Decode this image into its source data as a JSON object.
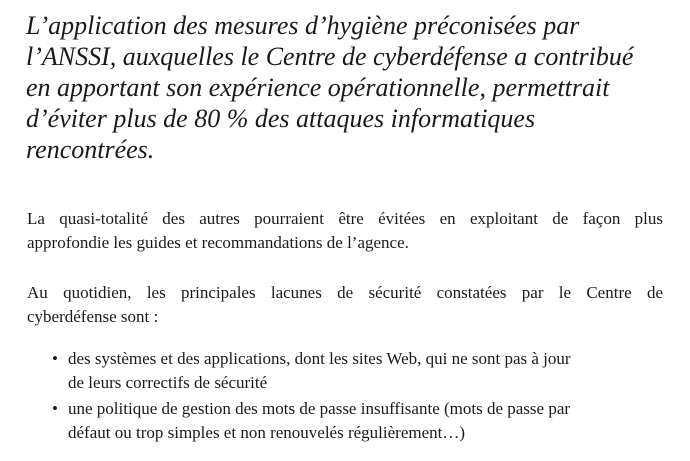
{
  "lead": {
    "lines": [
      "L’application des mesures d’hygiène préconisées par",
      "l’ANSSI, auxquelles le Centre de cyberdéfense a contribué",
      "en apportant son expérience opérationnelle, permettrait",
      "d’éviter plus de 80 % des attaques informatiques",
      "rencontrées."
    ]
  },
  "paragraph1": {
    "lines": [
      "La quasi-totalité des autres pourraient être évitées en exploitant de façon plus",
      "approfondie les guides et recommandations de l’agence."
    ]
  },
  "paragraph2": {
    "lines": [
      "Au quotidien, les principales lacunes de sécurité constatées par le Centre de",
      "cyberdéfense sont :"
    ]
  },
  "bullets": [
    {
      "marker": "•",
      "lines": [
        "des systèmes et des applications, dont les sites Web, qui ne sont pas à jour",
        "de leurs correctifs de sécurité"
      ]
    },
    {
      "marker": "•",
      "lines": [
        "une politique de gestion des mots de passe insuffisante (mots de passe par",
        "défaut ou trop simples et non renouvelés régulièrement…)"
      ]
    }
  ]
}
